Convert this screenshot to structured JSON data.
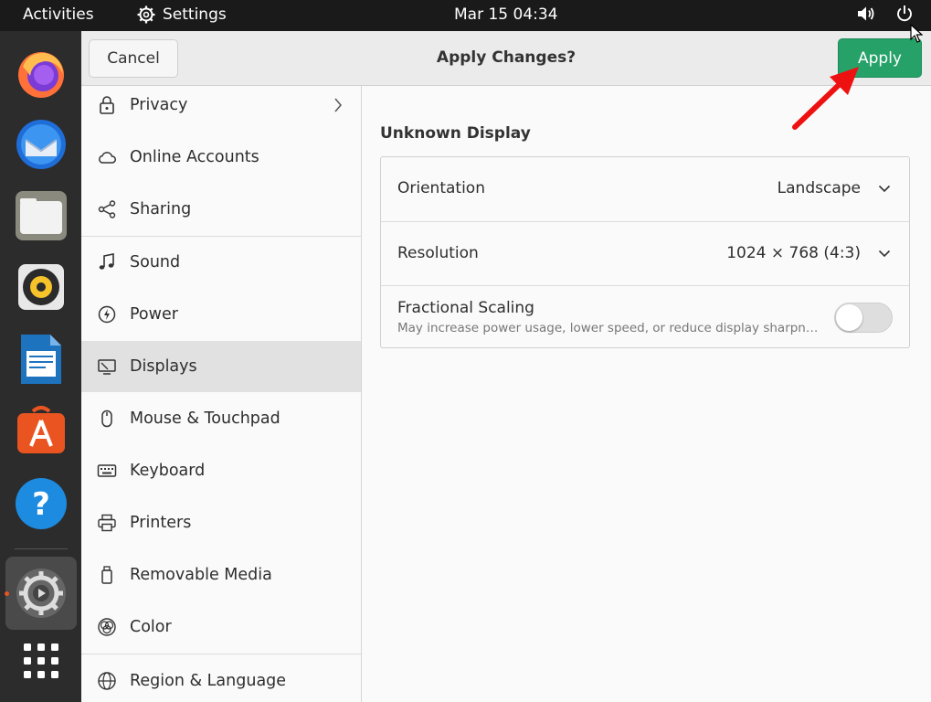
{
  "topbar": {
    "activities": "Activities",
    "app_name": "Settings",
    "clock": "Mar 15  04:34",
    "icons": [
      "volume-icon",
      "power-icon"
    ]
  },
  "dock": {
    "apps": [
      "firefox",
      "thunderbird",
      "files",
      "rhythmbox",
      "libreoffice-writer",
      "software-center",
      "help",
      "settings",
      "show-applications"
    ],
    "active": "settings"
  },
  "headerbar": {
    "cancel_label": "Cancel",
    "title": "Apply Changes?",
    "apply_label": "Apply"
  },
  "sidebar": {
    "items": [
      {
        "label": "Privacy",
        "icon": "lock-icon"
      },
      {
        "label": "Online Accounts",
        "icon": "cloud-icon"
      },
      {
        "label": "Sharing",
        "icon": "share-icon"
      },
      {
        "label": "Sound",
        "icon": "music-note-icon"
      },
      {
        "label": "Power",
        "icon": "power-icon"
      },
      {
        "label": "Displays",
        "icon": "display-icon"
      },
      {
        "label": "Mouse & Touchpad",
        "icon": "mouse-icon"
      },
      {
        "label": "Keyboard",
        "icon": "keyboard-icon"
      },
      {
        "label": "Printers",
        "icon": "printer-icon"
      },
      {
        "label": "Removable Media",
        "icon": "usb-icon"
      },
      {
        "label": "Color",
        "icon": "color-icon"
      },
      {
        "label": "Region & Language",
        "icon": "globe-icon"
      }
    ],
    "active": "Displays"
  },
  "content": {
    "section_title": "Unknown Display",
    "orientation": {
      "label": "Orientation",
      "value": "Landscape"
    },
    "resolution": {
      "label": "Resolution",
      "value": "1024 × 768 (4:3)"
    },
    "fractional_scaling": {
      "label": "Fractional Scaling",
      "description": "May increase power usage, lower speed, or reduce display sharpness.",
      "enabled": false
    }
  },
  "colors": {
    "apply_green": "#26a269",
    "annotation_red": "#ee1111",
    "dock_bg": "#2c2c2c",
    "topbar_bg": "#1a1a1a"
  }
}
